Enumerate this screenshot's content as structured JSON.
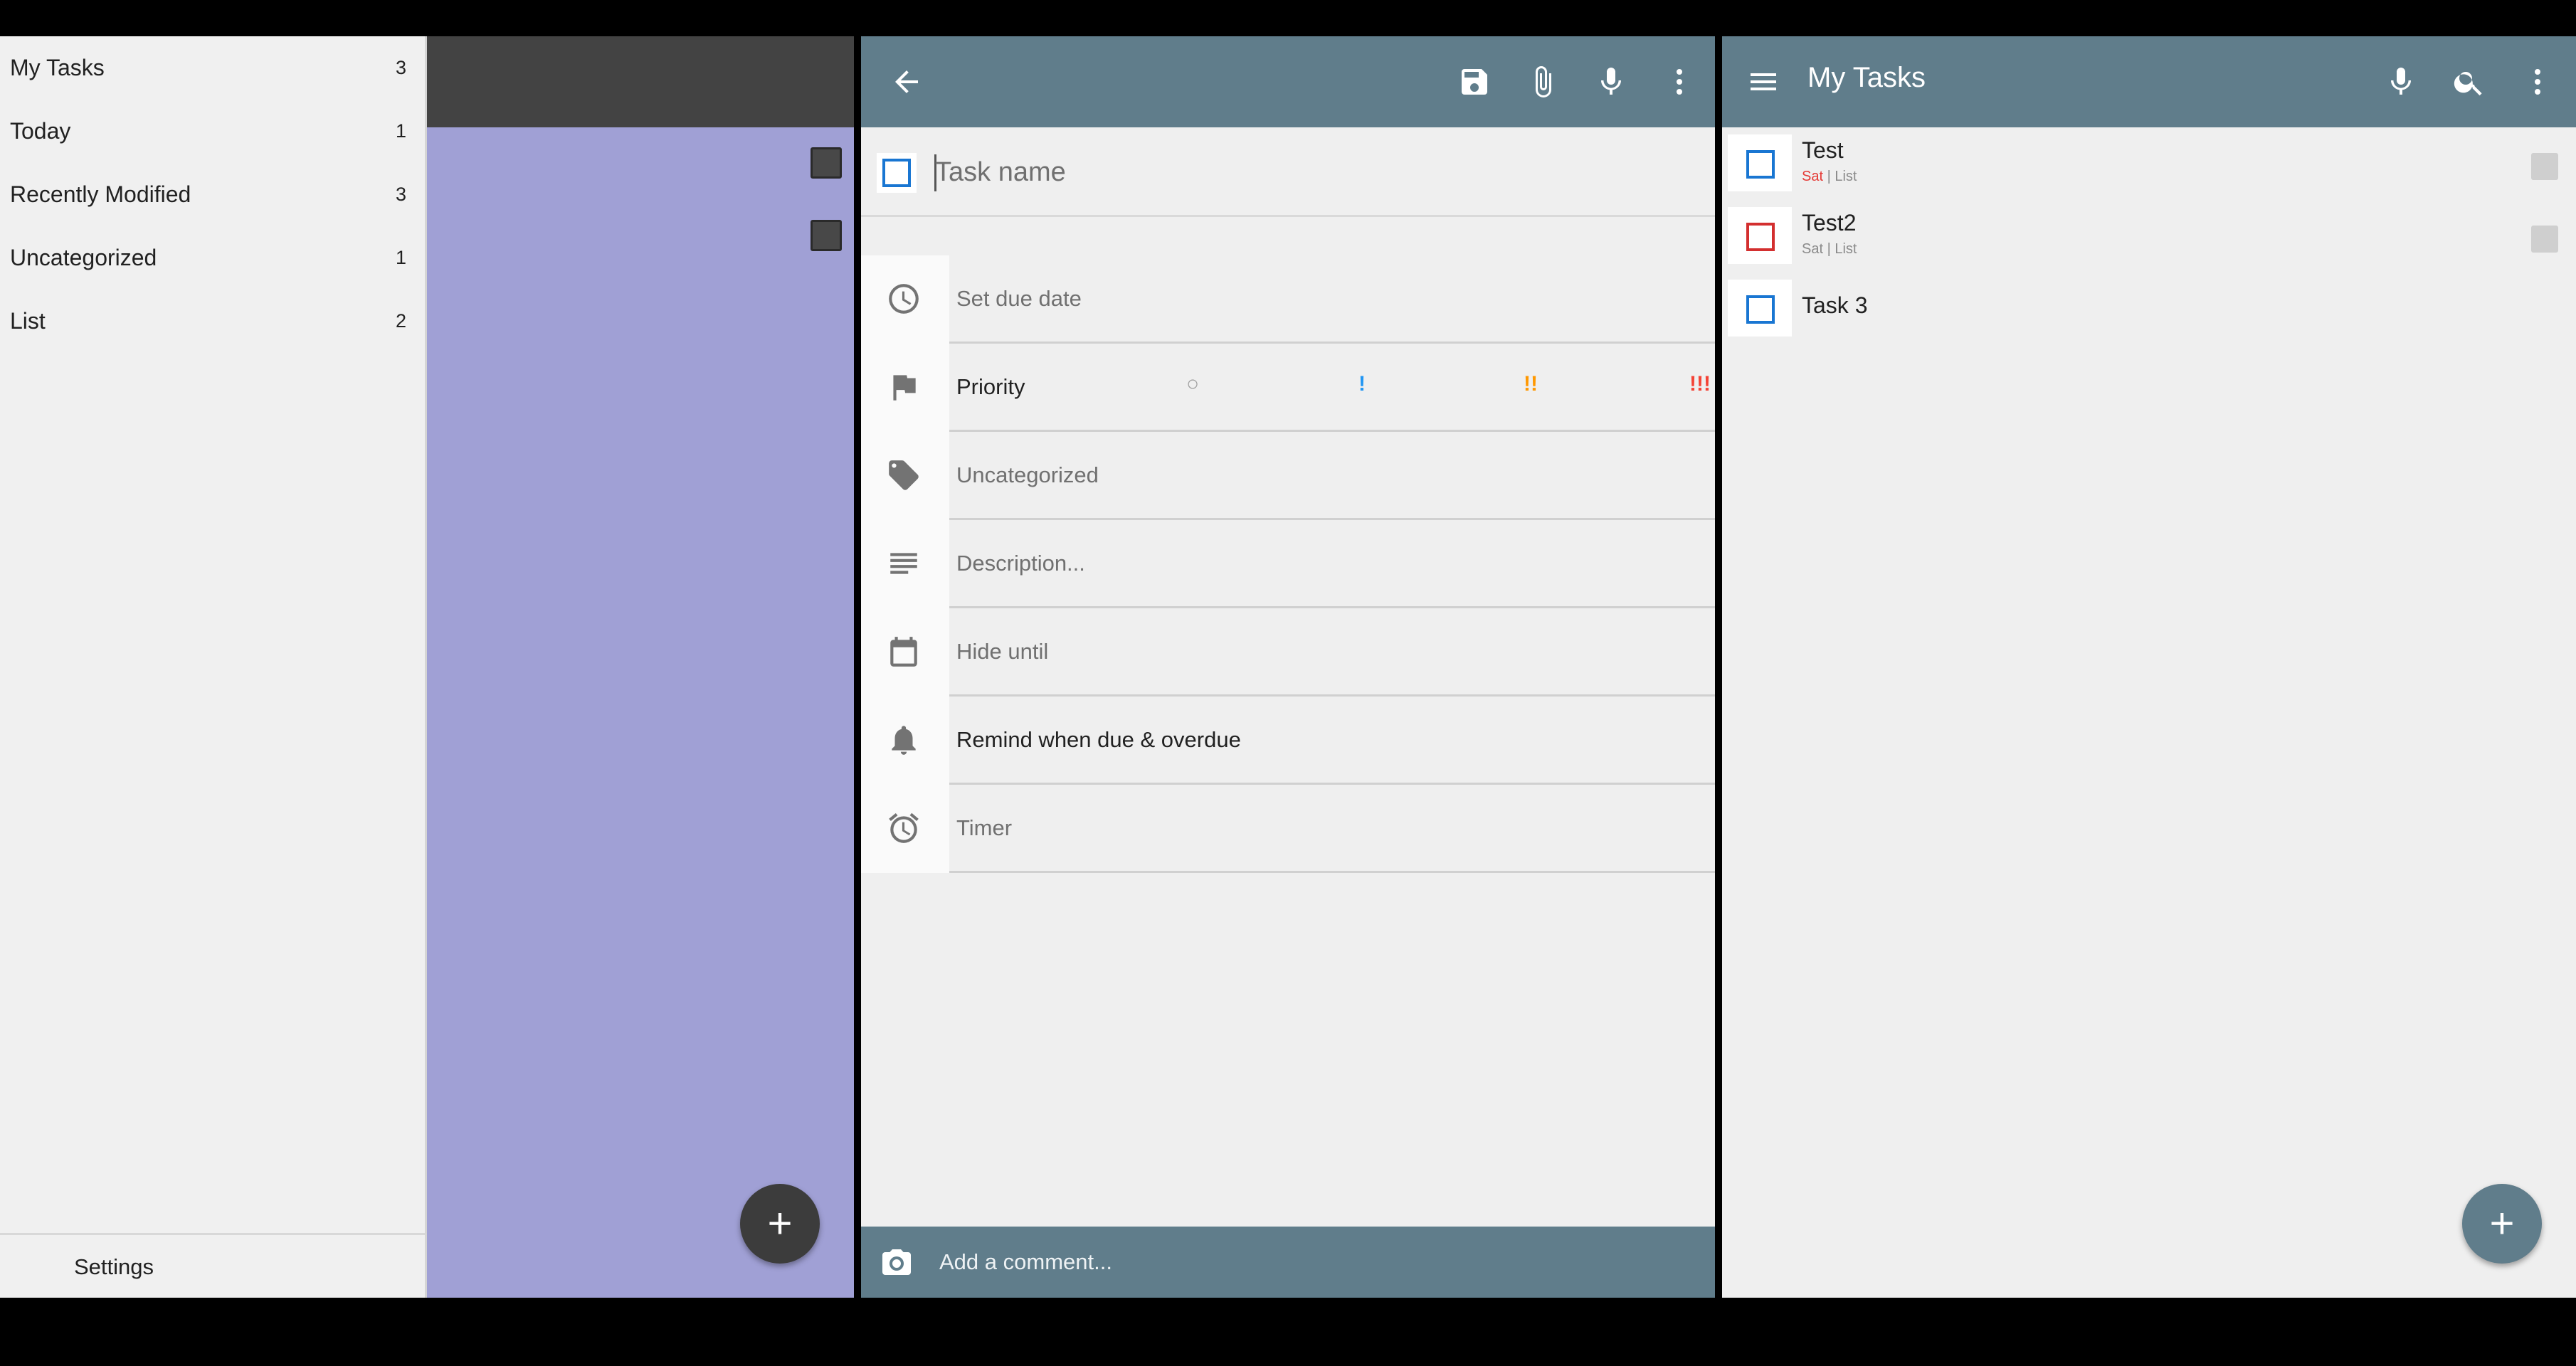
{
  "drawer": {
    "items": [
      {
        "label": "My Tasks",
        "count": "3"
      },
      {
        "label": "Today",
        "count": "1"
      },
      {
        "label": "Recently Modified",
        "count": "3"
      },
      {
        "label": "Uncategorized",
        "count": "1"
      },
      {
        "label": "List",
        "count": "2"
      }
    ],
    "settings_label": "Settings"
  },
  "list_pane": {
    "fab_label": "+",
    "fab_icon": "plus-icon"
  },
  "editor": {
    "toolbar_icons": [
      "back-arrow-icon",
      "save-icon",
      "attachment-icon",
      "microphone-icon",
      "overflow-menu-icon"
    ],
    "task_name_placeholder": "Task name",
    "rows": {
      "due_date": "Set due date",
      "priority": "Priority",
      "category": "Uncategorized",
      "description": "Description...",
      "hide_until": "Hide until",
      "reminder": "Remind when due & overdue",
      "timer": "Timer"
    },
    "priority_options": [
      {
        "label": "○",
        "color": "#9e9e9e"
      },
      {
        "label": "!",
        "color": "#2196f3"
      },
      {
        "label": "!!",
        "color": "#ff9800"
      },
      {
        "label": "!!!",
        "color": "#f44336"
      }
    ],
    "comment_placeholder": "Add a comment..."
  },
  "tasks": {
    "title": "My Tasks",
    "toolbar_icons": [
      "menu-icon",
      "microphone-icon",
      "search-icon",
      "overflow-menu-icon"
    ],
    "items": [
      {
        "title": "Test",
        "due": "Sat",
        "separator": "|",
        "list": "List",
        "check_color": "#1976d2",
        "due_color": "#e53935"
      },
      {
        "title": "Test2",
        "due": "Sat",
        "separator": "|",
        "list": "List",
        "check_color": "#d32f2f",
        "due_color": "#8a8a8a"
      },
      {
        "title": "Task 3",
        "check_color": "#1976d2"
      }
    ],
    "fab_label": "+"
  },
  "colors": {
    "toolbar": "#607d8b",
    "drawer_scrim": "#a0a0d5",
    "background": "#efefef"
  }
}
